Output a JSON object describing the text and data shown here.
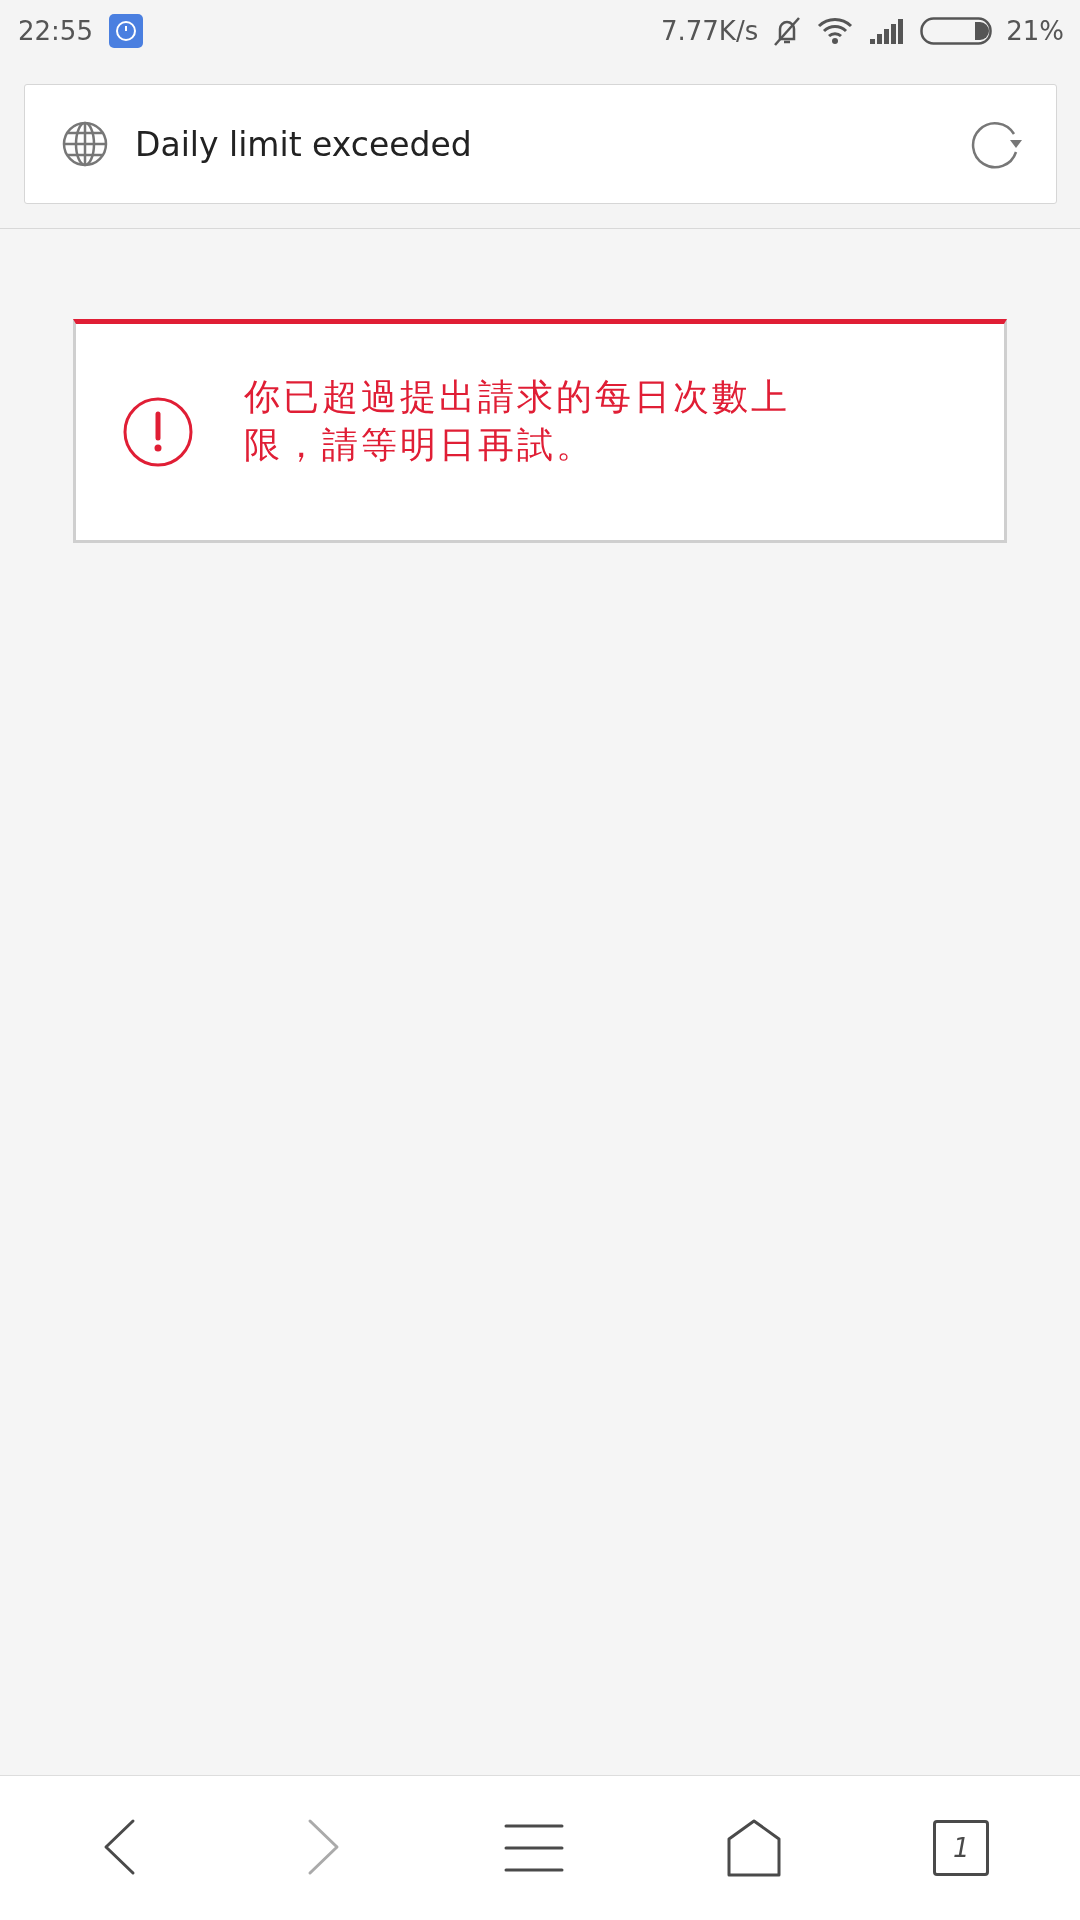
{
  "status_bar": {
    "time": "22:55",
    "network_speed": "7.77K/s",
    "battery": "21%"
  },
  "address_bar": {
    "title": "Daily limit exceeded"
  },
  "error": {
    "message": "你已超過提出請求的每日次數上限，請等明日再試。"
  },
  "bottom_nav": {
    "back": {
      "disabled": false
    },
    "forward": {
      "disabled": true
    },
    "tab_count": "1"
  }
}
